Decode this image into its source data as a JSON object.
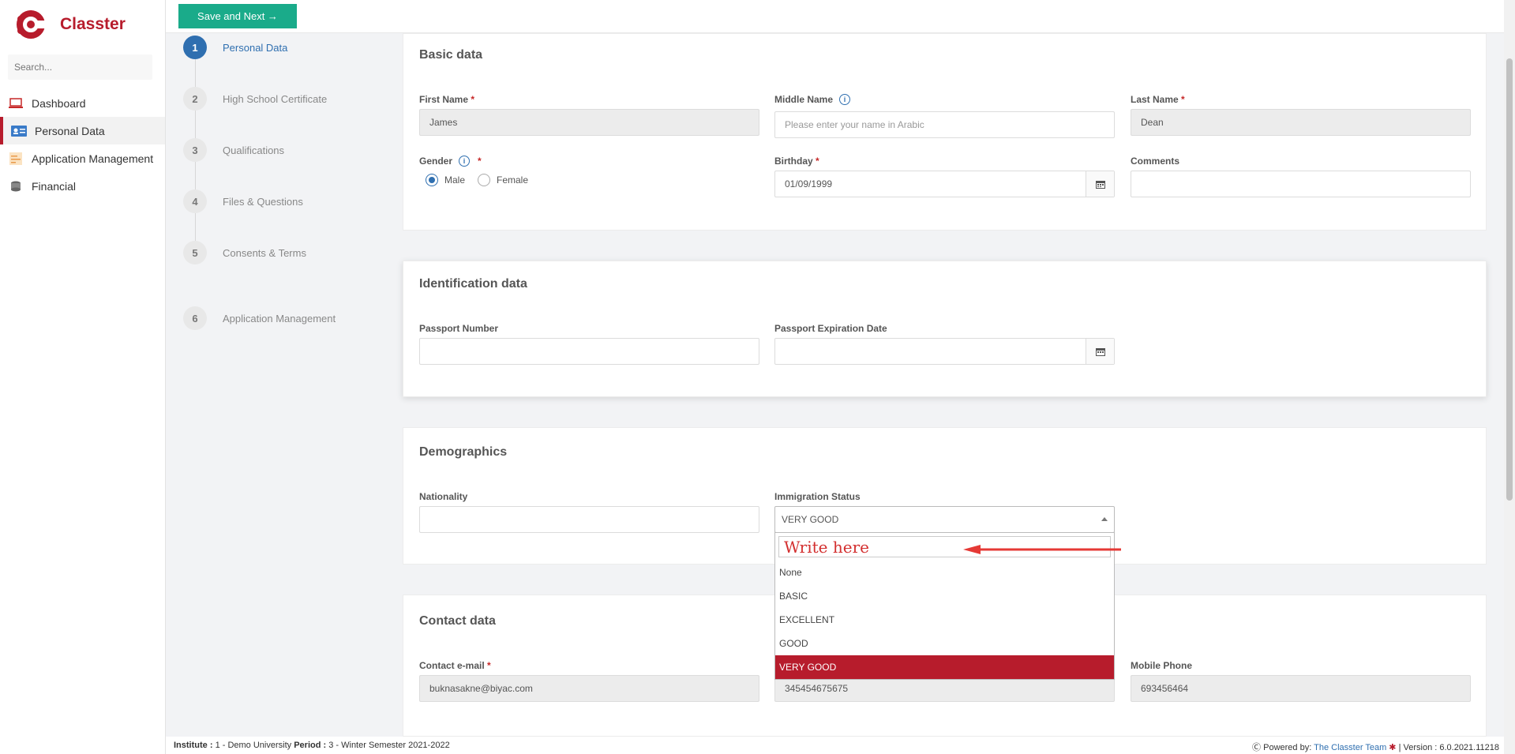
{
  "brand": {
    "name": "Classter"
  },
  "search": {
    "placeholder": "Search..."
  },
  "nav": [
    {
      "label": "Dashboard",
      "icon": "laptop-icon"
    },
    {
      "label": "Personal Data",
      "icon": "id-card-icon"
    },
    {
      "label": "Application Management",
      "icon": "document-icon"
    },
    {
      "label": "Financial",
      "icon": "coins-icon"
    }
  ],
  "toolbar": {
    "save_label": "Save and Next →"
  },
  "steps": [
    {
      "num": "1",
      "label": "Personal Data"
    },
    {
      "num": "2",
      "label": "High School Certificate"
    },
    {
      "num": "3",
      "label": "Qualifications"
    },
    {
      "num": "4",
      "label": "Files & Questions"
    },
    {
      "num": "5",
      "label": "Consents & Terms"
    },
    {
      "num": "6",
      "label": "Application Management"
    }
  ],
  "basic": {
    "title": "Basic data",
    "first_name_label": "First Name",
    "first_name": "James",
    "middle_name_label": "Middle Name",
    "middle_name_placeholder": "Please enter your name in Arabic",
    "last_name_label": "Last Name",
    "last_name": "Dean",
    "gender_label": "Gender",
    "gender_male": "Male",
    "gender_female": "Female",
    "birthday_label": "Birthday",
    "birthday": "01/09/1999",
    "comments_label": "Comments"
  },
  "identification": {
    "title": "Identification data",
    "passport_label": "Passport Number",
    "passport_exp_label": "Passport Expiration Date"
  },
  "demographics": {
    "title": "Demographics",
    "nationality_label": "Nationality",
    "immigration_label": "Immigration Status",
    "immigration_value": "VERY GOOD"
  },
  "dropdown": {
    "search_text": "Write here",
    "options": [
      "None",
      "BASIC",
      "EXCELLENT",
      "GOOD",
      "VERY GOOD"
    ],
    "selected": "VERY GOOD"
  },
  "contact": {
    "title": "Contact data",
    "email_label": "Contact e-mail",
    "email": "buknasakne@biyac.com",
    "phone": "345454675675",
    "mobile_label": "Mobile Phone",
    "mobile": "693456464"
  },
  "footer": {
    "institute_label": "Institute :",
    "institute": "1 - Demo University",
    "period_label": "Period :",
    "period": "3 - Winter Semester 2021-2022",
    "powered": "Powered by:",
    "team": "The Classter Team",
    "version": "| Version : 6.0.2021.11218"
  },
  "colors": {
    "brand": "#b71c2c",
    "accent": "#2f6fb0",
    "save": "#1aab8a"
  }
}
